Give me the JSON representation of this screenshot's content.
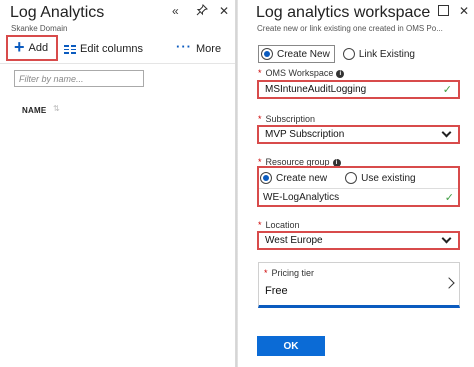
{
  "left_blade": {
    "title": "Log Analytics",
    "subtitle": "Skanke Domain",
    "toolbar": {
      "add_label": "Add",
      "edit_columns_label": "Edit columns",
      "more_label": "More"
    },
    "filter": {
      "placeholder": "Filter by name..."
    },
    "columns": [
      {
        "label": "NAME"
      }
    ]
  },
  "right_blade": {
    "title": "Log analytics workspace",
    "subtitle": "Create new or link existing one created in OMS Po...",
    "mode": {
      "create_new": "Create New",
      "link_existing": "Link Existing",
      "selected": "Create New"
    },
    "workspace": {
      "label": "OMS Workspace",
      "value": "MSIntuneAuditLogging"
    },
    "subscription": {
      "label": "Subscription",
      "value": "MVP Subscription"
    },
    "resource_group": {
      "label": "Resource group",
      "create_new": "Create new",
      "use_existing": "Use existing",
      "value": "WE-LogAnalytics"
    },
    "location": {
      "label": "Location",
      "value": "West Europe"
    },
    "pricing_tier": {
      "label": "Pricing tier",
      "value": "Free"
    },
    "ok_label": "OK"
  },
  "colors": {
    "accent": "#0b6bd6",
    "highlight": "#d84b4b",
    "valid": "#43a047"
  }
}
